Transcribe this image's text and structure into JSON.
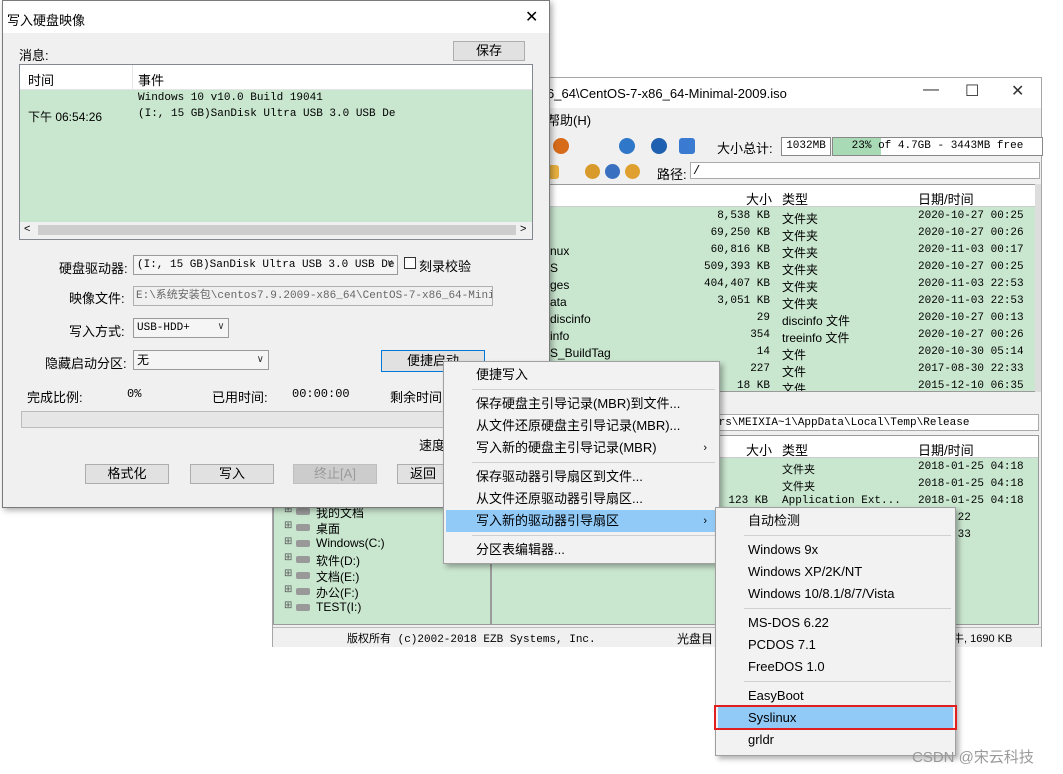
{
  "bg_window": {
    "title": "6_64\\CentOS-7-x86_64-Minimal-2009.iso",
    "menu_help": "帮助(H)",
    "size_total_label": "大小总计:",
    "size_total_value": "1032MB",
    "capacity_text": "23% of 4.7GB - 3443MB free",
    "capacity_percent": 23,
    "path_label": "路径:",
    "path_value": "/",
    "columns": {
      "size": "大小",
      "type": "类型",
      "date": "日期/时间"
    },
    "files": [
      {
        "name": "",
        "size": "8,538 KB",
        "type": "文件夹",
        "date": "2020-10-27 00:25"
      },
      {
        "name": "",
        "size": "69,250 KB",
        "type": "文件夹",
        "date": "2020-10-27 00:26"
      },
      {
        "name": "nux",
        "size": "60,816 KB",
        "type": "文件夹",
        "date": "2020-11-03 00:17"
      },
      {
        "name": "S",
        "size": "509,393 KB",
        "type": "文件夹",
        "date": "2020-10-27 00:25"
      },
      {
        "name": "ges",
        "size": "404,407 KB",
        "type": "文件夹",
        "date": "2020-11-03 22:53"
      },
      {
        "name": "ata",
        "size": "3,051 KB",
        "type": "文件夹",
        "date": "2020-11-03 22:53"
      },
      {
        "name": "discinfo",
        "size": "29",
        "type": "discinfo 文件",
        "date": "2020-10-27 00:13"
      },
      {
        "name": "info",
        "size": "354",
        "type": "treeinfo 文件",
        "date": "2020-10-27 00:26"
      },
      {
        "name": "S_BuildTag",
        "size": "14",
        "type": "文件",
        "date": "2020-10-30 05:14"
      },
      {
        "name": "",
        "size": "227",
        "type": "文件",
        "date": "2017-08-30 22:33"
      },
      {
        "name": "",
        "size": "18 KB",
        "type": "文件",
        "date": "2015-12-10 06:35"
      }
    ],
    "local_path": "ers\\MEIXIA~1\\AppData\\Local\\Temp\\Release",
    "local_files": [
      {
        "size": "",
        "type": "文件夹",
        "date": "2018-01-25 04:18"
      },
      {
        "size": "",
        "type": "文件夹",
        "date": "2018-01-25 04:18"
      },
      {
        "size": "123 KB",
        "type": "Application Ext...",
        "date": "2018-01-25 04:18"
      },
      {
        "size": "",
        "type": "",
        "date": "25 04:22"
      },
      {
        "size": "",
        "type": "",
        "date": "25 05:33"
      }
    ],
    "tree": [
      {
        "label": "我的文档"
      },
      {
        "label": "桌面"
      },
      {
        "label": "Windows(C:)"
      },
      {
        "label": "软件(D:)"
      },
      {
        "label": "文档(E:)"
      },
      {
        "label": "办公(F:)"
      },
      {
        "label": "TEST(I:)"
      }
    ],
    "status_copyright": "版权所有 (c)2002-2018 EZB Systems, Inc.",
    "status_disc": "光盘目",
    "status_right": "牛, 1690 KB"
  },
  "dialog": {
    "title": "写入硬盘映像",
    "messages_label": "消息:",
    "save_button": "保存",
    "log_columns": {
      "time": "时间",
      "event": "事件"
    },
    "log_rows": [
      {
        "time": "",
        "event": "Windows 10 v10.0 Build 19041"
      },
      {
        "time": "下午 06:54:26",
        "event": "(I:, 15 GB)SanDisk Ultra USB 3.0 USB De"
      }
    ],
    "drive_label": "硬盘驱动器:",
    "drive_value": "(I:, 15 GB)SanDisk Ultra USB 3.0 USB De",
    "verify_label": "刻录校验",
    "image_label": "映像文件:",
    "image_value": "E:\\系统安装包\\centos7.9.2009-x86_64\\CentOS-7-x86_64-Minimal",
    "write_mode_label": "写入方式:",
    "write_mode_value": "USB-HDD+",
    "hidden_part_label": "隐藏启动分区:",
    "hidden_part_value": "无",
    "quick_boot_button": "便捷启动",
    "progress_label": "完成比例:",
    "progress_value": "0%",
    "elapsed_label": "已用时间:",
    "elapsed_value": "00:00:00",
    "remaining_label": "剩余时间:",
    "speed_label": "速度",
    "format_button": "格式化",
    "write_button": "写入",
    "abort_button": "终止[A]",
    "return_button": "返回"
  },
  "context_menu": {
    "items": [
      {
        "label": "便捷写入"
      },
      {
        "label": "保存硬盘主引导记录(MBR)到文件..."
      },
      {
        "label": "从文件还原硬盘主引导记录(MBR)..."
      },
      {
        "label": "写入新的硬盘主引导记录(MBR)"
      },
      {
        "label": "保存驱动器引导扇区到文件..."
      },
      {
        "label": "从文件还原驱动器引导扇区..."
      },
      {
        "label": "写入新的驱动器引导扇区"
      },
      {
        "label": "分区表编辑器..."
      }
    ]
  },
  "submenu": {
    "items": [
      {
        "label": "自动检测"
      },
      {
        "label": "Windows 9x"
      },
      {
        "label": "Windows XP/2K/NT"
      },
      {
        "label": "Windows 10/8.1/8/7/Vista"
      },
      {
        "label": "MS-DOS 6.22"
      },
      {
        "label": "PCDOS 7.1"
      },
      {
        "label": "FreeDOS 1.0"
      },
      {
        "label": "EasyBoot"
      },
      {
        "label": "Syslinux"
      },
      {
        "label": "grldr"
      }
    ],
    "highlight_color": "#e02020"
  },
  "watermark": "CSDN @宋云科技"
}
